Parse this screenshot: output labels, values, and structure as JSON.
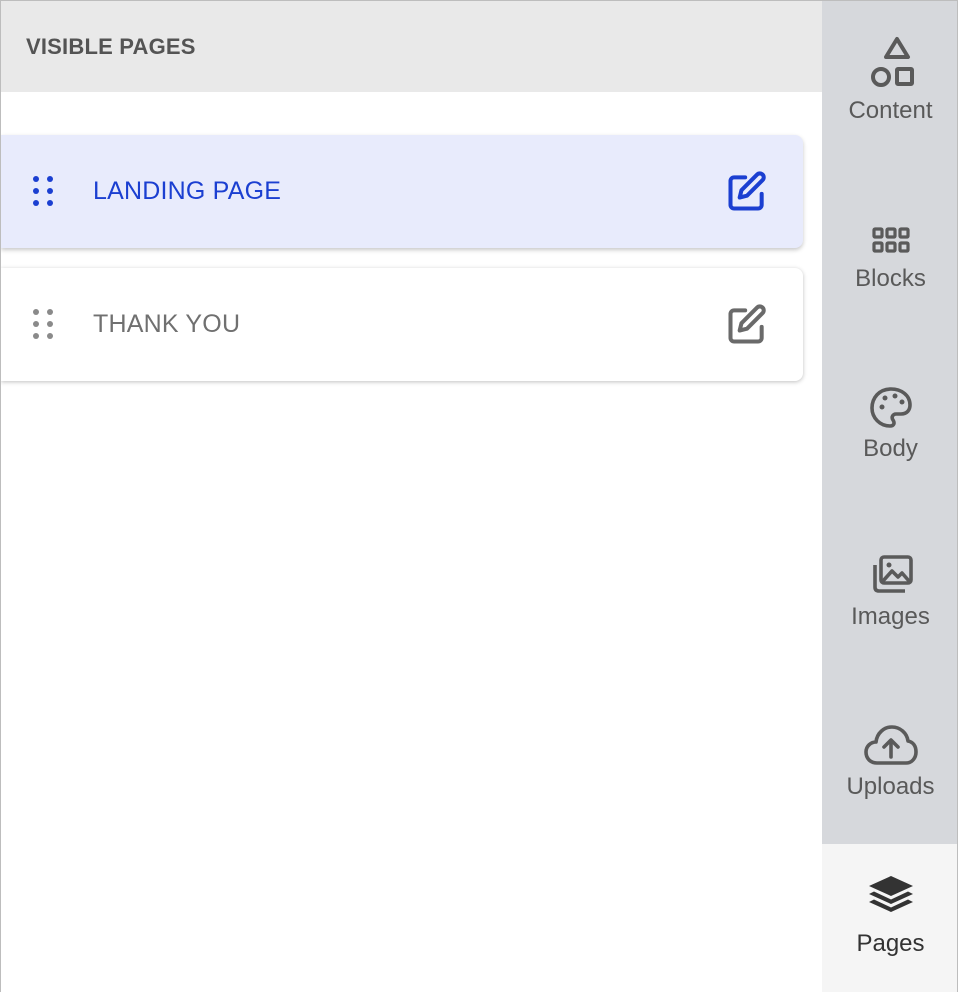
{
  "panel": {
    "title": "VISIBLE PAGES",
    "pages": [
      {
        "label": "LANDING PAGE",
        "state": "active"
      },
      {
        "label": "THANK YOU",
        "state": "inactive"
      }
    ]
  },
  "sidebar": {
    "items": [
      {
        "label": "Content",
        "icon": "shapes-icon"
      },
      {
        "label": "Blocks",
        "icon": "grid-icon"
      },
      {
        "label": "Body",
        "icon": "palette-icon"
      },
      {
        "label": "Images",
        "icon": "images-icon"
      },
      {
        "label": "Uploads",
        "icon": "cloud-upload-icon"
      },
      {
        "label": "Pages",
        "icon": "layers-icon",
        "selected": true
      }
    ]
  },
  "colors": {
    "accent": "#1b3fd1",
    "active_card_bg": "#e8ebfc",
    "sidebar_bg": "#d6d8dc",
    "header_bg": "#e9e9e9"
  }
}
